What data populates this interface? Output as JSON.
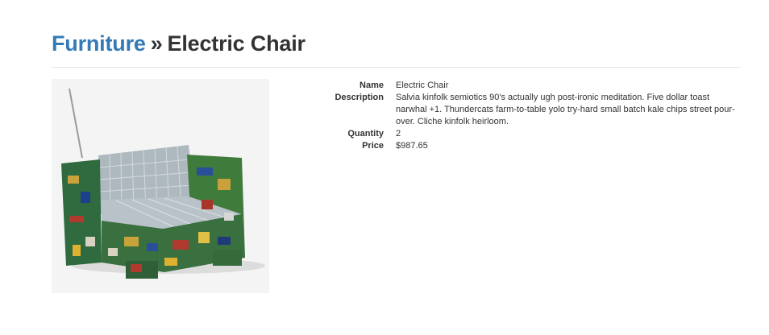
{
  "header": {
    "category_link": "Furniture",
    "separator": "»",
    "product_title": "Electric Chair"
  },
  "image": {
    "icon": "electronic-chair-photo"
  },
  "details": {
    "name_label": "Name",
    "name_value": "Electric Chair",
    "description_label": "Description",
    "description_value": "Salvia kinfolk semiotics 90's actually ugh post-ironic meditation. Five dollar toast narwhal +1. Thundercats farm-to-table yolo try-hard small batch kale chips street pour-over. Cliche kinfolk heirloom.",
    "quantity_label": "Quantity",
    "quantity_value": "2",
    "price_label": "Price",
    "price_value": "$987.65"
  }
}
